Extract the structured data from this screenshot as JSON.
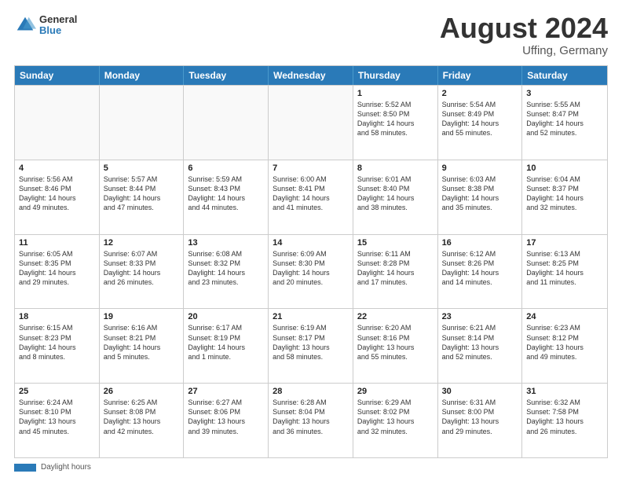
{
  "header": {
    "logo_line1": "General",
    "logo_line2": "Blue",
    "month_year": "August 2024",
    "location": "Uffing, Germany"
  },
  "days_of_week": [
    "Sunday",
    "Monday",
    "Tuesday",
    "Wednesday",
    "Thursday",
    "Friday",
    "Saturday"
  ],
  "footer": {
    "label": "Daylight hours"
  },
  "weeks": [
    [
      {
        "day": "",
        "empty": true
      },
      {
        "day": "",
        "empty": true
      },
      {
        "day": "",
        "empty": true
      },
      {
        "day": "",
        "empty": true
      },
      {
        "day": "1",
        "lines": [
          "Sunrise: 5:52 AM",
          "Sunset: 8:50 PM",
          "Daylight: 14 hours",
          "and 58 minutes."
        ]
      },
      {
        "day": "2",
        "lines": [
          "Sunrise: 5:54 AM",
          "Sunset: 8:49 PM",
          "Daylight: 14 hours",
          "and 55 minutes."
        ]
      },
      {
        "day": "3",
        "lines": [
          "Sunrise: 5:55 AM",
          "Sunset: 8:47 PM",
          "Daylight: 14 hours",
          "and 52 minutes."
        ]
      }
    ],
    [
      {
        "day": "4",
        "lines": [
          "Sunrise: 5:56 AM",
          "Sunset: 8:46 PM",
          "Daylight: 14 hours",
          "and 49 minutes."
        ]
      },
      {
        "day": "5",
        "lines": [
          "Sunrise: 5:57 AM",
          "Sunset: 8:44 PM",
          "Daylight: 14 hours",
          "and 47 minutes."
        ]
      },
      {
        "day": "6",
        "lines": [
          "Sunrise: 5:59 AM",
          "Sunset: 8:43 PM",
          "Daylight: 14 hours",
          "and 44 minutes."
        ]
      },
      {
        "day": "7",
        "lines": [
          "Sunrise: 6:00 AM",
          "Sunset: 8:41 PM",
          "Daylight: 14 hours",
          "and 41 minutes."
        ]
      },
      {
        "day": "8",
        "lines": [
          "Sunrise: 6:01 AM",
          "Sunset: 8:40 PM",
          "Daylight: 14 hours",
          "and 38 minutes."
        ]
      },
      {
        "day": "9",
        "lines": [
          "Sunrise: 6:03 AM",
          "Sunset: 8:38 PM",
          "Daylight: 14 hours",
          "and 35 minutes."
        ]
      },
      {
        "day": "10",
        "lines": [
          "Sunrise: 6:04 AM",
          "Sunset: 8:37 PM",
          "Daylight: 14 hours",
          "and 32 minutes."
        ]
      }
    ],
    [
      {
        "day": "11",
        "lines": [
          "Sunrise: 6:05 AM",
          "Sunset: 8:35 PM",
          "Daylight: 14 hours",
          "and 29 minutes."
        ]
      },
      {
        "day": "12",
        "lines": [
          "Sunrise: 6:07 AM",
          "Sunset: 8:33 PM",
          "Daylight: 14 hours",
          "and 26 minutes."
        ]
      },
      {
        "day": "13",
        "lines": [
          "Sunrise: 6:08 AM",
          "Sunset: 8:32 PM",
          "Daylight: 14 hours",
          "and 23 minutes."
        ]
      },
      {
        "day": "14",
        "lines": [
          "Sunrise: 6:09 AM",
          "Sunset: 8:30 PM",
          "Daylight: 14 hours",
          "and 20 minutes."
        ]
      },
      {
        "day": "15",
        "lines": [
          "Sunrise: 6:11 AM",
          "Sunset: 8:28 PM",
          "Daylight: 14 hours",
          "and 17 minutes."
        ]
      },
      {
        "day": "16",
        "lines": [
          "Sunrise: 6:12 AM",
          "Sunset: 8:26 PM",
          "Daylight: 14 hours",
          "and 14 minutes."
        ]
      },
      {
        "day": "17",
        "lines": [
          "Sunrise: 6:13 AM",
          "Sunset: 8:25 PM",
          "Daylight: 14 hours",
          "and 11 minutes."
        ]
      }
    ],
    [
      {
        "day": "18",
        "lines": [
          "Sunrise: 6:15 AM",
          "Sunset: 8:23 PM",
          "Daylight: 14 hours",
          "and 8 minutes."
        ]
      },
      {
        "day": "19",
        "lines": [
          "Sunrise: 6:16 AM",
          "Sunset: 8:21 PM",
          "Daylight: 14 hours",
          "and 5 minutes."
        ]
      },
      {
        "day": "20",
        "lines": [
          "Sunrise: 6:17 AM",
          "Sunset: 8:19 PM",
          "Daylight: 14 hours",
          "and 1 minute."
        ]
      },
      {
        "day": "21",
        "lines": [
          "Sunrise: 6:19 AM",
          "Sunset: 8:17 PM",
          "Daylight: 13 hours",
          "and 58 minutes."
        ]
      },
      {
        "day": "22",
        "lines": [
          "Sunrise: 6:20 AM",
          "Sunset: 8:16 PM",
          "Daylight: 13 hours",
          "and 55 minutes."
        ]
      },
      {
        "day": "23",
        "lines": [
          "Sunrise: 6:21 AM",
          "Sunset: 8:14 PM",
          "Daylight: 13 hours",
          "and 52 minutes."
        ]
      },
      {
        "day": "24",
        "lines": [
          "Sunrise: 6:23 AM",
          "Sunset: 8:12 PM",
          "Daylight: 13 hours",
          "and 49 minutes."
        ]
      }
    ],
    [
      {
        "day": "25",
        "lines": [
          "Sunrise: 6:24 AM",
          "Sunset: 8:10 PM",
          "Daylight: 13 hours",
          "and 45 minutes."
        ]
      },
      {
        "day": "26",
        "lines": [
          "Sunrise: 6:25 AM",
          "Sunset: 8:08 PM",
          "Daylight: 13 hours",
          "and 42 minutes."
        ]
      },
      {
        "day": "27",
        "lines": [
          "Sunrise: 6:27 AM",
          "Sunset: 8:06 PM",
          "Daylight: 13 hours",
          "and 39 minutes."
        ]
      },
      {
        "day": "28",
        "lines": [
          "Sunrise: 6:28 AM",
          "Sunset: 8:04 PM",
          "Daylight: 13 hours",
          "and 36 minutes."
        ]
      },
      {
        "day": "29",
        "lines": [
          "Sunrise: 6:29 AM",
          "Sunset: 8:02 PM",
          "Daylight: 13 hours",
          "and 32 minutes."
        ]
      },
      {
        "day": "30",
        "lines": [
          "Sunrise: 6:31 AM",
          "Sunset: 8:00 PM",
          "Daylight: 13 hours",
          "and 29 minutes."
        ]
      },
      {
        "day": "31",
        "lines": [
          "Sunrise: 6:32 AM",
          "Sunset: 7:58 PM",
          "Daylight: 13 hours",
          "and 26 minutes."
        ]
      }
    ]
  ]
}
